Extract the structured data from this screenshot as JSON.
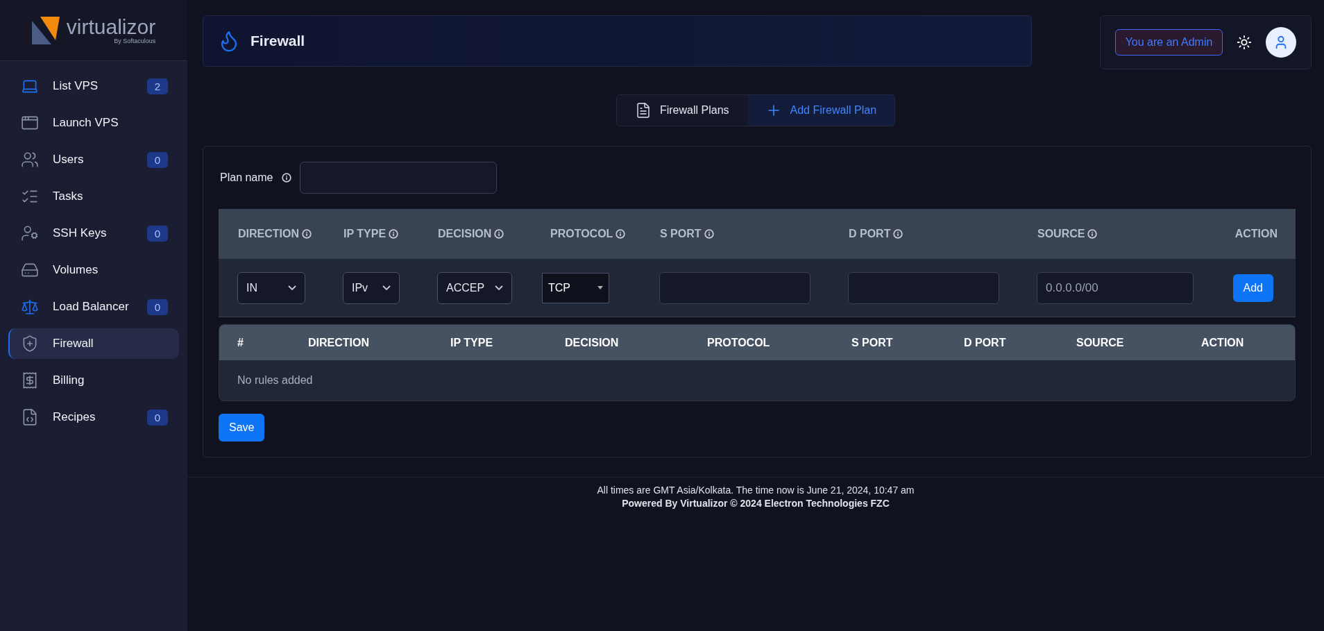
{
  "sidebar": {
    "logo": {
      "name": "virtualizor",
      "tagline": "By Softaculous"
    },
    "items": [
      {
        "label": "List VPS",
        "badge": "2",
        "selected": false
      },
      {
        "label": "Launch VPS",
        "selected": false
      },
      {
        "label": "Users",
        "badge": "0",
        "selected": false
      },
      {
        "label": "Tasks",
        "selected": false
      },
      {
        "label": "SSH Keys",
        "badge": "0",
        "selected": false
      },
      {
        "label": "Volumes",
        "selected": false
      },
      {
        "label": "Load Balancer",
        "badge": "0",
        "selected": false
      },
      {
        "label": "Firewall",
        "selected": true
      },
      {
        "label": "Billing",
        "selected": false
      },
      {
        "label": "Recipes",
        "badge": "0",
        "selected": false
      }
    ]
  },
  "header": {
    "title": "Firewall",
    "role_badge": "You are an Admin"
  },
  "tabs": [
    {
      "label": "Firewall Plans",
      "selected": false
    },
    {
      "label": "Add Firewall Plan",
      "selected": true
    }
  ],
  "form": {
    "plan_name": {
      "label": "Plan name"
    },
    "rule_columns": [
      {
        "label": "DIRECTION",
        "info": true
      },
      {
        "label": "IP TYPE",
        "info": true
      },
      {
        "label": "DECISION",
        "info": true
      },
      {
        "label": "PROTOCOL",
        "info": true
      },
      {
        "label": "S PORT",
        "info": true
      },
      {
        "label": "D PORT",
        "info": true
      },
      {
        "label": "SOURCE",
        "info": true
      },
      {
        "label": "ACTION",
        "info": false
      }
    ],
    "rule_inputs": [
      {
        "kind": "select",
        "value": "IN"
      },
      {
        "kind": "select",
        "value": "IPv"
      },
      {
        "kind": "select",
        "value": "ACCEP"
      },
      {
        "kind": "dropdown",
        "value": "TCP"
      },
      {
        "kind": "text"
      },
      {
        "kind": "text"
      },
      {
        "kind": "text",
        "placeholder": "0.0.0.0/00"
      },
      {
        "kind": "button",
        "label": "Add"
      }
    ],
    "rules_table": {
      "columns": [
        "#",
        "DIRECTION",
        "IP TYPE",
        "DECISION",
        "PROTOCOL",
        "S PORT",
        "D PORT",
        "SOURCE",
        "ACTION"
      ],
      "empty": "No rules added"
    },
    "save": "Save"
  },
  "footer": {
    "time": "All times are GMT Asia/Kolkata. The time now is June 21, 2024, 10:47 am",
    "powered": "Powered By Virtualizor © 2024 Electron Technologies FZC"
  }
}
